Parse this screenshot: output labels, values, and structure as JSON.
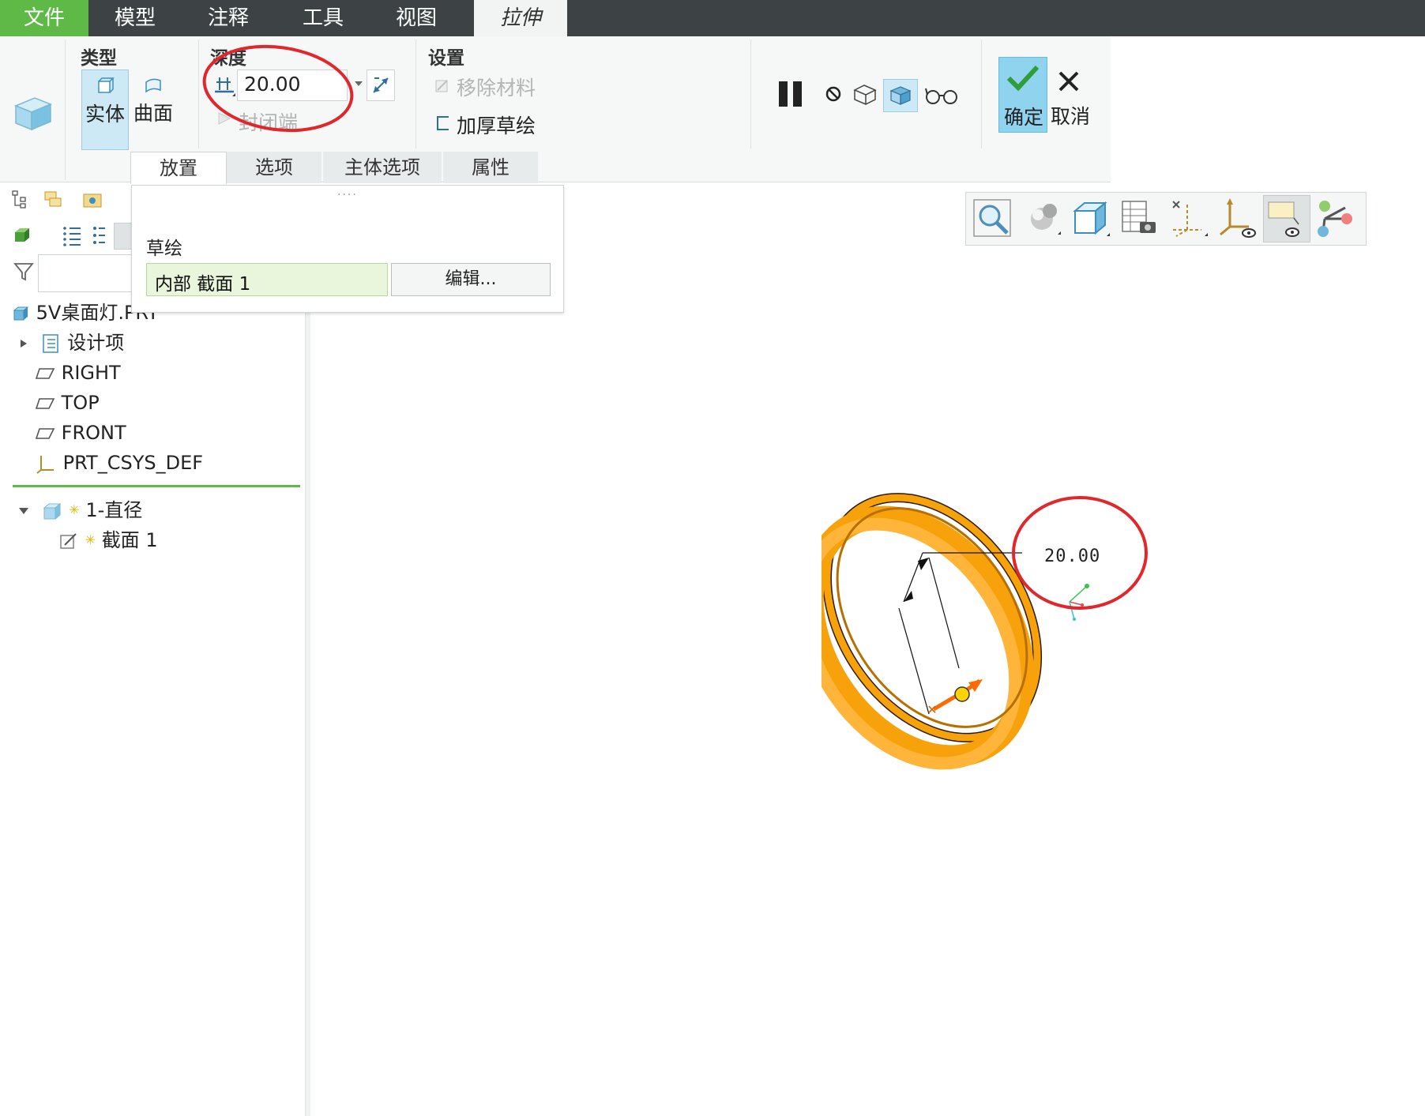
{
  "menubar": {
    "items": [
      "文件",
      "模型",
      "注释",
      "工具",
      "视图"
    ],
    "active_tab": "拉伸"
  },
  "ribbon": {
    "type_group": {
      "label": "类型",
      "solid": "实体",
      "surface": "曲面"
    },
    "depth_group": {
      "label": "深度",
      "value": "20.00",
      "cap_ends": "封闭端"
    },
    "settings_group": {
      "label": "设置",
      "remove_material": "移除材料",
      "thicken_sketch": "加厚草绘"
    },
    "confirm": "确定",
    "cancel": "取消",
    "tabs": [
      "放置",
      "选项",
      "主体选项",
      "属性"
    ]
  },
  "placement_panel": {
    "sketch_label": "草绘",
    "sketch_value": "内部 截面 1",
    "edit_button": "编辑..."
  },
  "model_tree": {
    "root": "5V桌面灯.PRT",
    "items": [
      "设计项",
      "RIGHT",
      "TOP",
      "FRONT",
      "PRT_CSYS_DEF"
    ],
    "feature": "1-直径",
    "feature_child": "截面 1"
  },
  "viewport": {
    "dimension": "20.00"
  },
  "colors": {
    "file_menu": "#5fb946",
    "menubar": "#3d4345",
    "extrude_body": "#f7a20a",
    "highlight_circle": "#e0282c",
    "confirm_bg": "#8fd3ef",
    "sketch_field": "#e9f6dc"
  }
}
